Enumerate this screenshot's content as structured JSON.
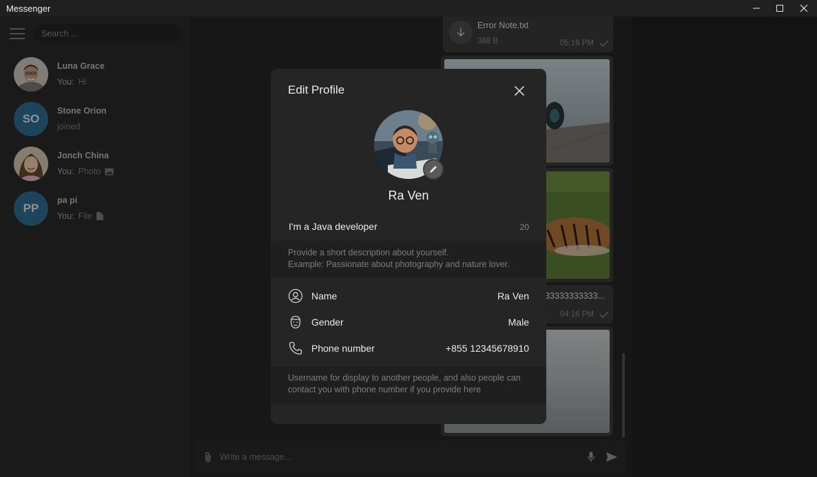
{
  "window": {
    "title": "Messenger"
  },
  "sidebar": {
    "search_placeholder": "Search ...",
    "contacts": [
      {
        "name": "Luna Grace",
        "prefix": "You:",
        "message": "Hi",
        "avatar": "photo"
      },
      {
        "name": "Stone Orion",
        "prefix": "",
        "message": "joined",
        "avatar": "SO"
      },
      {
        "name": "Jonch China",
        "prefix": "You:",
        "message": "Photo",
        "avatar": "photo",
        "icon": "image-icon"
      },
      {
        "name": "pa pi",
        "prefix": "You:",
        "message": "File",
        "avatar": "PP",
        "icon": "file-icon"
      }
    ]
  },
  "chat": {
    "file_message": {
      "filename": "Error Note.txt",
      "size": "368 B",
      "time": "05:16 PM"
    },
    "text_message": {
      "text": "3333333333333...",
      "time": "04:16 PM"
    },
    "composer_placeholder": "Write a message..."
  },
  "dialog": {
    "title": "Edit Profile",
    "name": "Ra Ven",
    "bio": "I'm a Java developer",
    "bio_remaining": "20",
    "bio_hint_line1": "Provide a short description about yourself.",
    "bio_hint_line2": "Example: Passionate about photography and nature lover.",
    "fields": [
      {
        "label": "Name",
        "value": "Ra Ven",
        "icon": "user-circle-icon"
      },
      {
        "label": "Gender",
        "value": "Male",
        "icon": "face-icon"
      },
      {
        "label": "Phone number",
        "value": "+855 12345678910",
        "icon": "phone-icon"
      }
    ],
    "footer_hint_line1": "Username for display to another people, and also people can",
    "footer_hint_line2": "contact you with phone number if you provide here"
  },
  "colors": {
    "accent_avatar": "#2f6f92",
    "dialog_bg": "#252525",
    "overlay": "rgba(0,0,0,0.38)"
  }
}
